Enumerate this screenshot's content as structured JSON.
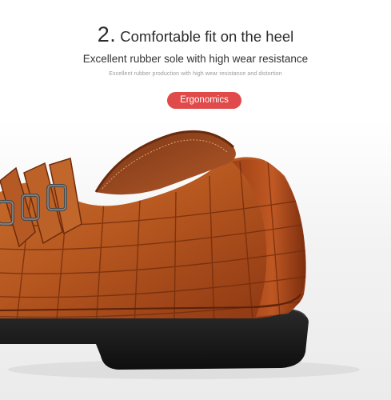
{
  "header": {
    "number": "2.",
    "title": "Comfortable fit on the heel",
    "subtitle": "Excellent rubber sole with high wear resistance",
    "caption": "Excellent rubber production with high wear resistance and distortion"
  },
  "badge": {
    "label": "Ergonomics",
    "color": "#e04a4a"
  },
  "product_image": {
    "icon": "shoe-heel-photo",
    "colors": {
      "leather": "#b5561f",
      "sole": "#151515"
    }
  }
}
